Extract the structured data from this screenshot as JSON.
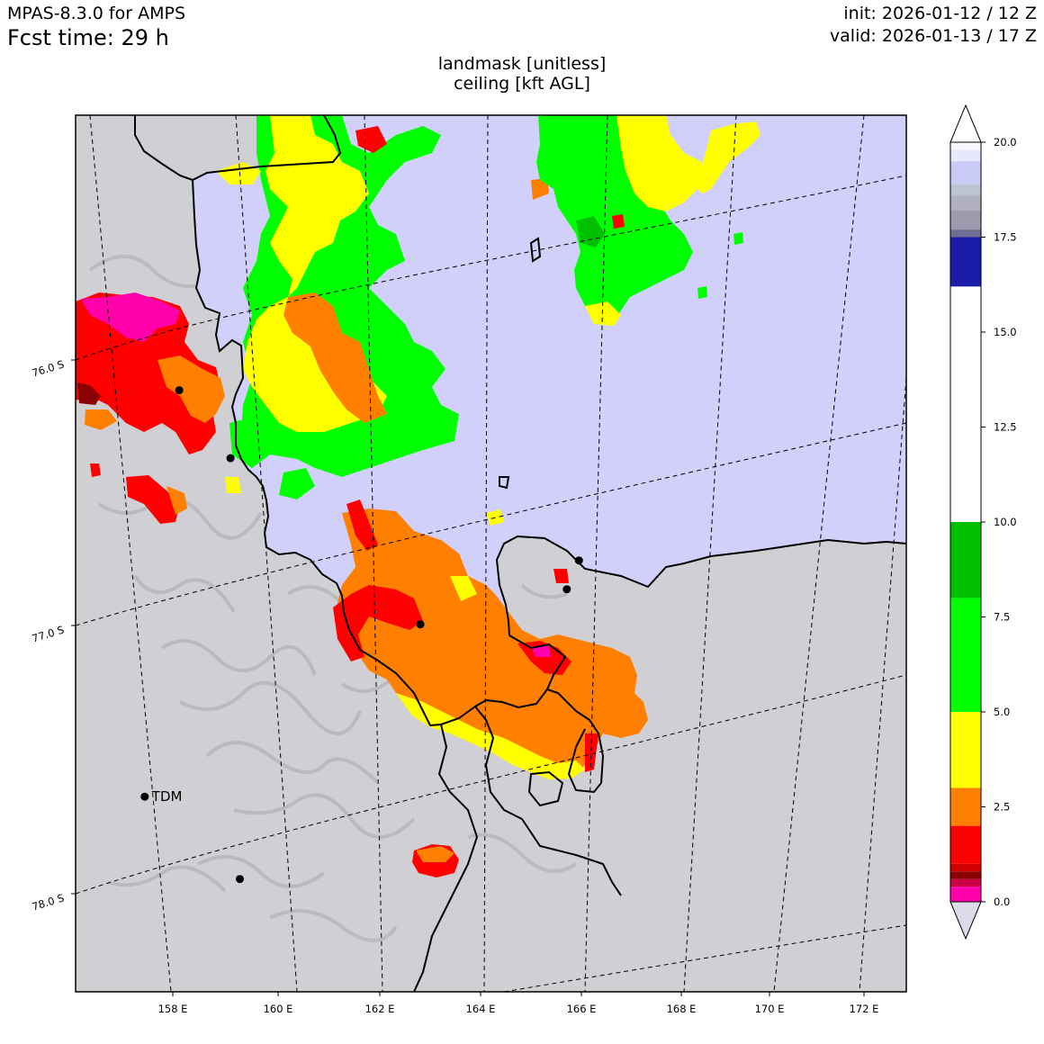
{
  "header": {
    "model": "MPAS-8.3.0 for AMPS",
    "fcst_time": "Fcst time:   29 h",
    "init": "init: 2026-01-12 / 12 Z",
    "valid": "valid: 2026-01-13 / 17 Z"
  },
  "map": {
    "title_line1": "landmask [unitless]",
    "title_line2": "ceiling [kft AGL]",
    "lon_labels": [
      "158 E",
      "160 E",
      "162 E",
      "164 E",
      "166 E",
      "168 E",
      "170 E",
      "172 E"
    ],
    "lat_labels": [
      "76.0 S",
      "77.0 S",
      "78.0 S"
    ],
    "stations": [
      {
        "name": "",
        "lon": 159.0,
        "lat": -76.2
      },
      {
        "name": "",
        "lon": 159.7,
        "lat": -76.5
      },
      {
        "name": "",
        "lon": 162.8,
        "lat": -77.3
      },
      {
        "name": "",
        "lon": 165.7,
        "lat": -77.2
      },
      {
        "name": "",
        "lon": 165.5,
        "lat": -77.3
      },
      {
        "name": "TDM",
        "lon": 157.4,
        "lat": -77.7
      },
      {
        "name": "",
        "lon": 159.0,
        "lat": -78.1
      }
    ],
    "colors": {
      "sea": "#d0d0fa",
      "land": "#d0d0d4",
      "red": "#ff0000",
      "orange": "#ff7f00",
      "yellow": "#ffff00",
      "green": "#00ff00",
      "dark_green": "#00c000",
      "navy": "#1c1caa",
      "magenta": "#ff00aa",
      "dark_red": "#8b0000"
    }
  },
  "colorbar": {
    "tick_labels": [
      "0.0",
      "2.5",
      "5.0",
      "7.5",
      "10.0",
      "12.5",
      "15.0",
      "17.5",
      "20.0"
    ],
    "ticks": [
      0,
      2.5,
      5,
      7.5,
      10,
      12.5,
      15,
      17.5,
      20
    ],
    "range": [
      0,
      20
    ],
    "segments": [
      {
        "from": 0,
        "to": 0.4,
        "color": "#ff00aa"
      },
      {
        "from": 0.4,
        "to": 0.6,
        "color": "#cc0044"
      },
      {
        "from": 0.6,
        "to": 0.8,
        "color": "#8b0000"
      },
      {
        "from": 0.8,
        "to": 1.0,
        "color": "#d00000"
      },
      {
        "from": 1.0,
        "to": 2.0,
        "color": "#ff0000"
      },
      {
        "from": 2.0,
        "to": 3.0,
        "color": "#ff7f00"
      },
      {
        "from": 3.0,
        "to": 5.0,
        "color": "#ffff00"
      },
      {
        "from": 5.0,
        "to": 8.0,
        "color": "#00ff00"
      },
      {
        "from": 8.0,
        "to": 10.0,
        "color": "#00c000"
      },
      {
        "from": 10.0,
        "to": 16.2,
        "color": "#ffffff"
      },
      {
        "from": 16.2,
        "to": 17.5,
        "color": "#1c1caa"
      },
      {
        "from": 17.5,
        "to": 17.7,
        "color": "#6e6e92"
      },
      {
        "from": 17.7,
        "to": 18.2,
        "color": "#9c9cae"
      },
      {
        "from": 18.2,
        "to": 18.6,
        "color": "#b0b0c0"
      },
      {
        "from": 18.6,
        "to": 18.9,
        "color": "#bcc4d4"
      },
      {
        "from": 18.9,
        "to": 19.5,
        "color": "#cacaf6"
      },
      {
        "from": 19.5,
        "to": 19.8,
        "color": "#e8e8fc"
      },
      {
        "from": 19.8,
        "to": 20.0,
        "color": "#f6f6ff"
      }
    ],
    "under_color": "#dcdce8",
    "over_color": "#ffffff"
  }
}
